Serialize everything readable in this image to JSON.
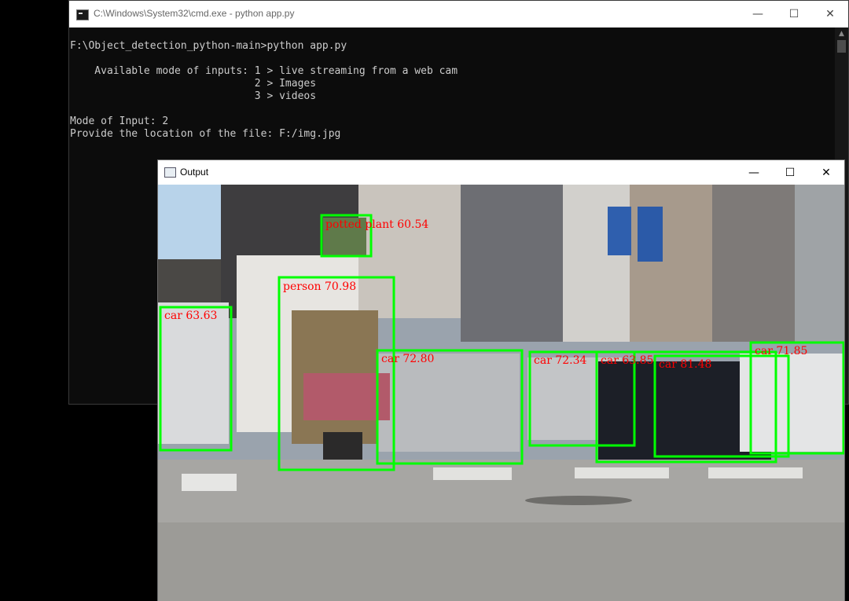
{
  "cmd": {
    "title": "C:\\Windows\\System32\\cmd.exe - python  app.py",
    "lines": [
      "F:\\Object_detection_python-main>python app.py",
      "",
      "    Available mode of inputs: 1 > live streaming from a web cam",
      "                              2 > Images",
      "                              3 > videos",
      "",
      "Mode of Input: 2",
      "Provide the location of the file: F:/img.jpg"
    ],
    "controls": {
      "minimize": "—",
      "maximize": "☐",
      "close": "✕"
    }
  },
  "output": {
    "title": "Output",
    "controls": {
      "minimize": "—",
      "maximize": "☐",
      "close": "✕"
    },
    "detections": [
      {
        "label": "car 63.63"
      },
      {
        "label": "potted plant  60.54"
      },
      {
        "label": "person  70.98"
      },
      {
        "label": "car 72.80"
      },
      {
        "label": "car 72.34"
      },
      {
        "label": "car 63.85"
      },
      {
        "label": "car 81.48"
      },
      {
        "label": "car 71.85"
      }
    ],
    "box_color": "#00ff00",
    "label_color": "#ff0000"
  }
}
